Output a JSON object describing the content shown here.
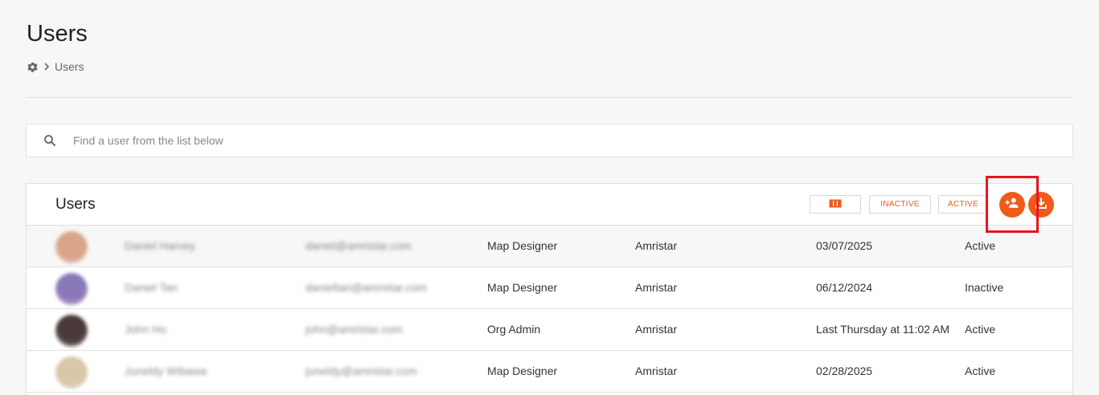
{
  "page": {
    "title": "Users",
    "breadcrumb": {
      "icon": "gear-icon",
      "separator": ">",
      "current": "Users"
    }
  },
  "search": {
    "placeholder": "Find a user from the list below",
    "value": "",
    "icon": "search-icon"
  },
  "card": {
    "title": "Users",
    "toolbar": {
      "columns_icon": "columns-icon",
      "inactive_label": "INACTIVE",
      "active_label": "ACTIVE",
      "add_user_icon": "add-user-icon",
      "download_icon": "download-icon"
    }
  },
  "colors": {
    "accent": "#f05a1a",
    "highlight": "#e8141b"
  },
  "users": [
    {
      "name": "Daniel Harvey",
      "email": "daniel@amristar.com",
      "role": "Map Designer",
      "organization": "Amristar",
      "last_active": "03/07/2025",
      "status": "Active",
      "avatar_color": "#d9a48a"
    },
    {
      "name": "Daniel Tan",
      "email": "danieltan@amristar.com",
      "role": "Map Designer",
      "organization": "Amristar",
      "last_active": "06/12/2024",
      "status": "Inactive",
      "avatar_color": "#8a78b8"
    },
    {
      "name": "John Ho",
      "email": "john@amristar.com",
      "role": "Org Admin",
      "organization": "Amristar",
      "last_active": "Last Thursday at 11:02 AM",
      "status": "Active",
      "avatar_color": "#4a3a3a"
    },
    {
      "name": "Juneldy Wibawa",
      "email": "juneldy@amristar.com",
      "role": "Map Designer",
      "organization": "Amristar",
      "last_active": "02/28/2025",
      "status": "Active",
      "avatar_color": "#d8c8a8"
    }
  ]
}
